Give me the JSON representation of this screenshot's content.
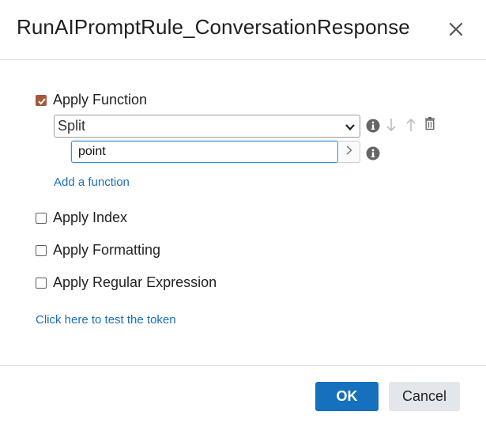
{
  "dialog": {
    "title": "RunAIPromptRule_ConversationResponse",
    "close_icon": "close-icon"
  },
  "apply_function": {
    "label": "Apply Function",
    "checked": true,
    "function_select": {
      "value": "Split"
    },
    "parameter": {
      "value": "point"
    },
    "add_function_label": "Add a function"
  },
  "options": [
    {
      "label": "Apply Index",
      "checked": false
    },
    {
      "label": "Apply Formatting",
      "checked": false
    },
    {
      "label": "Apply Regular Expression",
      "checked": false
    }
  ],
  "test_token_label": "Click here to test the token",
  "footer": {
    "ok_label": "OK",
    "cancel_label": "Cancel"
  },
  "colors": {
    "accent": "#1670be",
    "checkbox_checked": "#a8573b",
    "link": "#1a6fb5"
  }
}
